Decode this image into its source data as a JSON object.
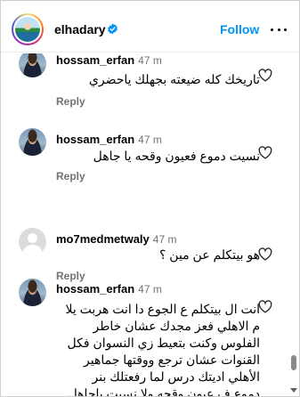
{
  "header": {
    "username": "elhadary",
    "follow_label": "Follow"
  },
  "comments": [
    {
      "username": "hossam_erfan",
      "time": "47 m",
      "text": "تاريخك كله ضيعته بجهلك ياحضري",
      "reply_label": "Reply",
      "avatar": "photo"
    },
    {
      "username": "hossam_erfan",
      "time": "47 m",
      "text": "نسيت دموع فعيون وقحه يا جاهل",
      "reply_label": "Reply",
      "avatar": "photo"
    },
    {
      "username": "mo7medmetwaly",
      "time": "47 m",
      "text": "هو بيتكلم عن مين ؟",
      "reply_label": "Reply",
      "avatar": "default"
    },
    {
      "username": "hossam_erfan",
      "time": "47 m",
      "text_lines": [
        "انت ال بيتكلم ع الجوع دا انت هربت يلا",
        "م الاهلي فعز مجدك عشان خاطر",
        "الفلوس وكنت بتعيط زي النسوان فكل",
        "القنوات عشان ترجع ووقتها جماهير",
        "الأهلي اديتك درس لما رفعتلك بنر",
        "دموع ف عيون وقحه ولا نسيت ياجاهل"
      ],
      "avatar": "photo"
    }
  ],
  "colors": {
    "accent": "#0095f6",
    "verified": "#0095f6",
    "muted": "#737373"
  }
}
